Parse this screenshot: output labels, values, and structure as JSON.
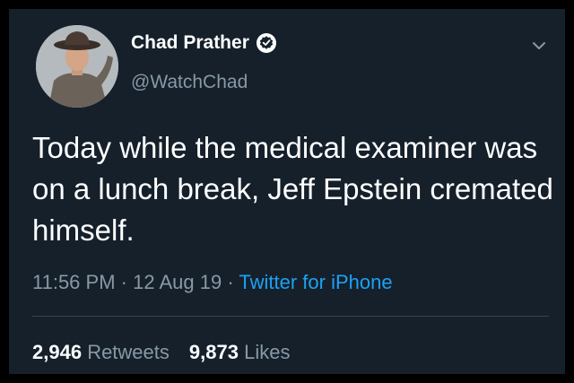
{
  "user": {
    "name": "Chad Prather",
    "handle": "@WatchChad",
    "verified": true
  },
  "tweet": {
    "text": "Today while the medical examiner was on a lunch break, Jeff Epstein cremated himself.",
    "time": "11:56 PM",
    "separator": "·",
    "date": "12 Aug 19",
    "source": "Twitter for iPhone"
  },
  "stats": {
    "retweets_count": "2,946",
    "retweets_label": "Retweets",
    "likes_count": "9,873",
    "likes_label": "Likes"
  },
  "icons": {
    "verified": "verified-badge-icon",
    "menu": "chevron-down-icon"
  },
  "colors": {
    "background": "#15202b",
    "link": "#1da1f2",
    "muted": "#8899a6",
    "text": "#ffffff"
  }
}
